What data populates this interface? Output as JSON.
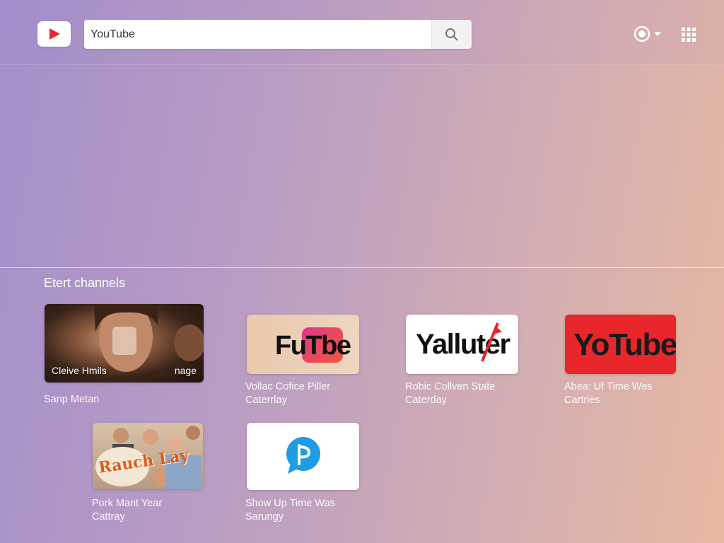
{
  "header": {
    "search": {
      "value": "YouTube",
      "placeholder": ""
    },
    "icons": {
      "logo": "play-icon",
      "search": "search-icon",
      "account": "account-icon",
      "apps": "apps-grid-icon"
    }
  },
  "section": {
    "title": "Etert channels"
  },
  "cards": [
    {
      "overlay_left": "Cleive Hmils",
      "overlay_right": "nage",
      "caption_line1": "Sanp Metan",
      "caption_line2": ""
    },
    {
      "logo_text": "FuTbe",
      "caption_line1": "Vollac Cofice Piller",
      "caption_line2": "Caterrlay"
    },
    {
      "logo_text": "Yalluter",
      "caption_line1": "Robic Collven State",
      "caption_line2": "Caterday"
    },
    {
      "logo_text": "YoTube",
      "caption_line1": "Abea: Uf Time Wes",
      "caption_line2": "Cartries"
    },
    {
      "overlay_text": "Rauch Lay",
      "caption_line1": "Pork Mant Year",
      "caption_line2": "Cattray"
    },
    {
      "icon": "chat-bubble-icon",
      "caption_line1": "Show Up Time Was",
      "caption_line2": "Sarungy"
    }
  ],
  "colors": {
    "brand_red": "#e8262b",
    "chat_blue": "#1e9de3",
    "pink": "#d4147a"
  }
}
